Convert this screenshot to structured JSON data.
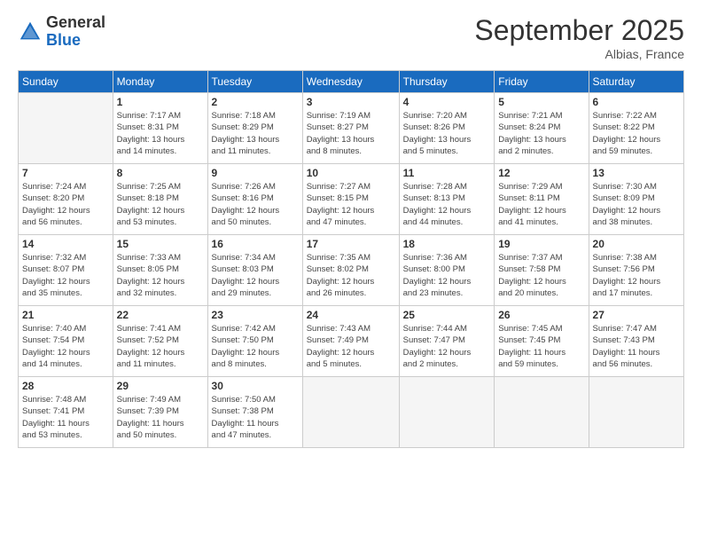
{
  "header": {
    "logo_general": "General",
    "logo_blue": "Blue",
    "month_title": "September 2025",
    "location": "Albias, France"
  },
  "weekdays": [
    "Sunday",
    "Monday",
    "Tuesday",
    "Wednesday",
    "Thursday",
    "Friday",
    "Saturday"
  ],
  "weeks": [
    [
      {
        "day": "",
        "info": ""
      },
      {
        "day": "1",
        "info": "Sunrise: 7:17 AM\nSunset: 8:31 PM\nDaylight: 13 hours\nand 14 minutes."
      },
      {
        "day": "2",
        "info": "Sunrise: 7:18 AM\nSunset: 8:29 PM\nDaylight: 13 hours\nand 11 minutes."
      },
      {
        "day": "3",
        "info": "Sunrise: 7:19 AM\nSunset: 8:27 PM\nDaylight: 13 hours\nand 8 minutes."
      },
      {
        "day": "4",
        "info": "Sunrise: 7:20 AM\nSunset: 8:26 PM\nDaylight: 13 hours\nand 5 minutes."
      },
      {
        "day": "5",
        "info": "Sunrise: 7:21 AM\nSunset: 8:24 PM\nDaylight: 13 hours\nand 2 minutes."
      },
      {
        "day": "6",
        "info": "Sunrise: 7:22 AM\nSunset: 8:22 PM\nDaylight: 12 hours\nand 59 minutes."
      }
    ],
    [
      {
        "day": "7",
        "info": "Sunrise: 7:24 AM\nSunset: 8:20 PM\nDaylight: 12 hours\nand 56 minutes."
      },
      {
        "day": "8",
        "info": "Sunrise: 7:25 AM\nSunset: 8:18 PM\nDaylight: 12 hours\nand 53 minutes."
      },
      {
        "day": "9",
        "info": "Sunrise: 7:26 AM\nSunset: 8:16 PM\nDaylight: 12 hours\nand 50 minutes."
      },
      {
        "day": "10",
        "info": "Sunrise: 7:27 AM\nSunset: 8:15 PM\nDaylight: 12 hours\nand 47 minutes."
      },
      {
        "day": "11",
        "info": "Sunrise: 7:28 AM\nSunset: 8:13 PM\nDaylight: 12 hours\nand 44 minutes."
      },
      {
        "day": "12",
        "info": "Sunrise: 7:29 AM\nSunset: 8:11 PM\nDaylight: 12 hours\nand 41 minutes."
      },
      {
        "day": "13",
        "info": "Sunrise: 7:30 AM\nSunset: 8:09 PM\nDaylight: 12 hours\nand 38 minutes."
      }
    ],
    [
      {
        "day": "14",
        "info": "Sunrise: 7:32 AM\nSunset: 8:07 PM\nDaylight: 12 hours\nand 35 minutes."
      },
      {
        "day": "15",
        "info": "Sunrise: 7:33 AM\nSunset: 8:05 PM\nDaylight: 12 hours\nand 32 minutes."
      },
      {
        "day": "16",
        "info": "Sunrise: 7:34 AM\nSunset: 8:03 PM\nDaylight: 12 hours\nand 29 minutes."
      },
      {
        "day": "17",
        "info": "Sunrise: 7:35 AM\nSunset: 8:02 PM\nDaylight: 12 hours\nand 26 minutes."
      },
      {
        "day": "18",
        "info": "Sunrise: 7:36 AM\nSunset: 8:00 PM\nDaylight: 12 hours\nand 23 minutes."
      },
      {
        "day": "19",
        "info": "Sunrise: 7:37 AM\nSunset: 7:58 PM\nDaylight: 12 hours\nand 20 minutes."
      },
      {
        "day": "20",
        "info": "Sunrise: 7:38 AM\nSunset: 7:56 PM\nDaylight: 12 hours\nand 17 minutes."
      }
    ],
    [
      {
        "day": "21",
        "info": "Sunrise: 7:40 AM\nSunset: 7:54 PM\nDaylight: 12 hours\nand 14 minutes."
      },
      {
        "day": "22",
        "info": "Sunrise: 7:41 AM\nSunset: 7:52 PM\nDaylight: 12 hours\nand 11 minutes."
      },
      {
        "day": "23",
        "info": "Sunrise: 7:42 AM\nSunset: 7:50 PM\nDaylight: 12 hours\nand 8 minutes."
      },
      {
        "day": "24",
        "info": "Sunrise: 7:43 AM\nSunset: 7:49 PM\nDaylight: 12 hours\nand 5 minutes."
      },
      {
        "day": "25",
        "info": "Sunrise: 7:44 AM\nSunset: 7:47 PM\nDaylight: 12 hours\nand 2 minutes."
      },
      {
        "day": "26",
        "info": "Sunrise: 7:45 AM\nSunset: 7:45 PM\nDaylight: 11 hours\nand 59 minutes."
      },
      {
        "day": "27",
        "info": "Sunrise: 7:47 AM\nSunset: 7:43 PM\nDaylight: 11 hours\nand 56 minutes."
      }
    ],
    [
      {
        "day": "28",
        "info": "Sunrise: 7:48 AM\nSunset: 7:41 PM\nDaylight: 11 hours\nand 53 minutes."
      },
      {
        "day": "29",
        "info": "Sunrise: 7:49 AM\nSunset: 7:39 PM\nDaylight: 11 hours\nand 50 minutes."
      },
      {
        "day": "30",
        "info": "Sunrise: 7:50 AM\nSunset: 7:38 PM\nDaylight: 11 hours\nand 47 minutes."
      },
      {
        "day": "",
        "info": ""
      },
      {
        "day": "",
        "info": ""
      },
      {
        "day": "",
        "info": ""
      },
      {
        "day": "",
        "info": ""
      }
    ]
  ]
}
